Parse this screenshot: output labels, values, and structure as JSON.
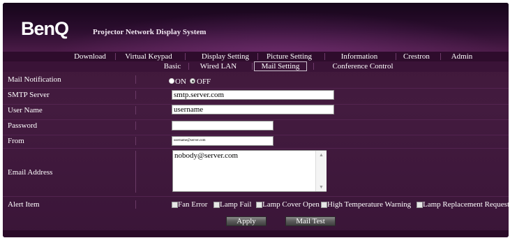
{
  "header": {
    "logo": "BenQ",
    "system_title": "Projector Network Display System"
  },
  "main_nav": [
    "Download",
    "Virtual Keypad",
    "Display Setting",
    "Picture Setting",
    "Information",
    "Crestron",
    "Admin"
  ],
  "sub_nav": [
    "Basic",
    "Wired LAN",
    "Mail Setting",
    "Conference Control"
  ],
  "active_sub_nav": "Mail Setting",
  "form": {
    "mail_notification": {
      "label": "Mail Notification",
      "on_label": "ON",
      "off_label": "OFF",
      "selected": "OFF"
    },
    "smtp_server": {
      "label": "SMTP Server",
      "value": "smtp.server.com"
    },
    "user_name": {
      "label": "User Name",
      "value": "username"
    },
    "password": {
      "label": "Password",
      "value": ""
    },
    "from": {
      "label": "From",
      "value": "username@server.com"
    },
    "email_address": {
      "label": "Email Address",
      "value": "nobody@server.com"
    },
    "alert_item": {
      "label": "Alert Item",
      "options": [
        "Fan Error",
        "Lamp Fail",
        "Lamp Cover Open",
        "High Temperature Warning",
        "Lamp Replacement Request"
      ]
    }
  },
  "buttons": {
    "apply": "Apply",
    "mail_test": "Mail Test"
  },
  "colors": {
    "background": "#431b3f",
    "header_dark": "#16051a",
    "nav_bar": "#2e0c2c",
    "input_bg": "#ffffff"
  }
}
